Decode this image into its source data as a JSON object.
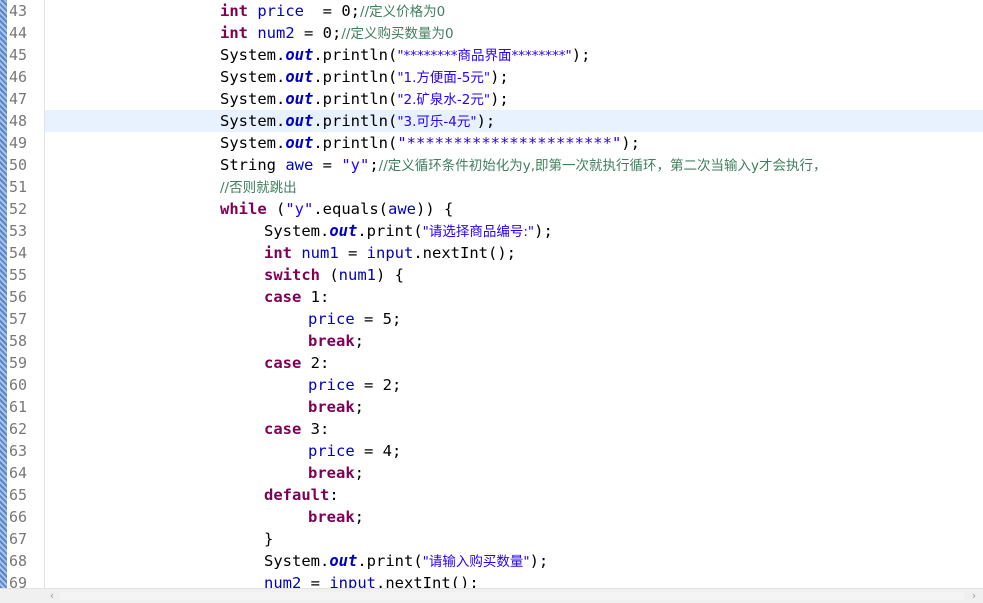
{
  "editor": {
    "lines": [
      {
        "num": "43",
        "indent": 4,
        "tokens": [
          {
            "t": "kw",
            "v": "int"
          },
          {
            "t": "pl",
            "v": " "
          },
          {
            "t": "fld",
            "v": "price"
          },
          {
            "t": "pl",
            "v": "  = 0;"
          },
          {
            "t": "cmt",
            "v": "//定义价格为0"
          }
        ]
      },
      {
        "num": "44",
        "indent": 4,
        "tokens": [
          {
            "t": "kw",
            "v": "int"
          },
          {
            "t": "pl",
            "v": " "
          },
          {
            "t": "fld",
            "v": "num2"
          },
          {
            "t": "pl",
            "v": " = 0;"
          },
          {
            "t": "cmt",
            "v": "//定义购买数量为0"
          }
        ]
      },
      {
        "num": "45",
        "indent": 4,
        "tokens": [
          {
            "t": "pl",
            "v": "System."
          },
          {
            "t": "sfld",
            "v": "out"
          },
          {
            "t": "pl",
            "v": ".println("
          },
          {
            "t": "str",
            "v": "\"********商品界面********\""
          },
          {
            "t": "pl",
            "v": ");"
          }
        ]
      },
      {
        "num": "46",
        "indent": 4,
        "tokens": [
          {
            "t": "pl",
            "v": "System."
          },
          {
            "t": "sfld",
            "v": "out"
          },
          {
            "t": "pl",
            "v": ".println("
          },
          {
            "t": "str",
            "v": "\"1.方便面-5元\""
          },
          {
            "t": "pl",
            "v": ");"
          }
        ]
      },
      {
        "num": "47",
        "indent": 4,
        "tokens": [
          {
            "t": "pl",
            "v": "System."
          },
          {
            "t": "sfld",
            "v": "out"
          },
          {
            "t": "pl",
            "v": ".println("
          },
          {
            "t": "str",
            "v": "\"2.矿泉水-2元\""
          },
          {
            "t": "pl",
            "v": ");"
          }
        ]
      },
      {
        "num": "48",
        "indent": 4,
        "current": true,
        "tokens": [
          {
            "t": "pl",
            "v": "System."
          },
          {
            "t": "sfld",
            "v": "out"
          },
          {
            "t": "pl",
            "v": ".println("
          },
          {
            "t": "str",
            "v": "\"3.可乐-4元\""
          },
          {
            "t": "pl",
            "v": ");"
          }
        ]
      },
      {
        "num": "49",
        "indent": 4,
        "tokens": [
          {
            "t": "pl",
            "v": "System."
          },
          {
            "t": "sfld",
            "v": "out"
          },
          {
            "t": "pl",
            "v": ".println("
          },
          {
            "t": "str",
            "v": "\"**********************\""
          },
          {
            "t": "pl",
            "v": ");"
          }
        ]
      },
      {
        "num": "50",
        "indent": 4,
        "tokens": [
          {
            "t": "pl",
            "v": "String "
          },
          {
            "t": "fld",
            "v": "awe"
          },
          {
            "t": "pl",
            "v": " = "
          },
          {
            "t": "str",
            "v": "\"y\""
          },
          {
            "t": "pl",
            "v": ";"
          },
          {
            "t": "cmt",
            "v": "//定义循环条件初始化为y,即第一次就执行循环，第二次当输入y才会执行，"
          }
        ]
      },
      {
        "num": "51",
        "indent": 4,
        "tokens": [
          {
            "t": "cmt",
            "v": "//否则就跳出"
          }
        ]
      },
      {
        "num": "52",
        "indent": 4,
        "tokens": [
          {
            "t": "kw",
            "v": "while"
          },
          {
            "t": "pl",
            "v": " ("
          },
          {
            "t": "str",
            "v": "\"y\""
          },
          {
            "t": "pl",
            "v": ".equals("
          },
          {
            "t": "fld",
            "v": "awe"
          },
          {
            "t": "pl",
            "v": ")) {"
          }
        ]
      },
      {
        "num": "53",
        "indent": 5,
        "tokens": [
          {
            "t": "pl",
            "v": "System."
          },
          {
            "t": "sfld",
            "v": "out"
          },
          {
            "t": "pl",
            "v": ".print("
          },
          {
            "t": "str",
            "v": "\"请选择商品编号:\""
          },
          {
            "t": "pl",
            "v": ");"
          }
        ]
      },
      {
        "num": "54",
        "indent": 5,
        "tokens": [
          {
            "t": "kw",
            "v": "int"
          },
          {
            "t": "pl",
            "v": " "
          },
          {
            "t": "fld",
            "v": "num1"
          },
          {
            "t": "pl",
            "v": " = "
          },
          {
            "t": "fld",
            "v": "input"
          },
          {
            "t": "pl",
            "v": ".nextInt();"
          }
        ]
      },
      {
        "num": "55",
        "indent": 5,
        "tokens": [
          {
            "t": "kw",
            "v": "switch"
          },
          {
            "t": "pl",
            "v": " ("
          },
          {
            "t": "fld",
            "v": "num1"
          },
          {
            "t": "pl",
            "v": ") {"
          }
        ]
      },
      {
        "num": "56",
        "indent": 5,
        "tokens": [
          {
            "t": "kw",
            "v": "case"
          },
          {
            "t": "pl",
            "v": " 1:"
          }
        ]
      },
      {
        "num": "57",
        "indent": 6,
        "tokens": [
          {
            "t": "fld",
            "v": "price"
          },
          {
            "t": "pl",
            "v": " = 5;"
          }
        ]
      },
      {
        "num": "58",
        "indent": 6,
        "tokens": [
          {
            "t": "kw",
            "v": "break"
          },
          {
            "t": "pl",
            "v": ";"
          }
        ]
      },
      {
        "num": "59",
        "indent": 5,
        "tokens": [
          {
            "t": "kw",
            "v": "case"
          },
          {
            "t": "pl",
            "v": " 2:"
          }
        ]
      },
      {
        "num": "60",
        "indent": 6,
        "tokens": [
          {
            "t": "fld",
            "v": "price"
          },
          {
            "t": "pl",
            "v": " = 2;"
          }
        ]
      },
      {
        "num": "61",
        "indent": 6,
        "tokens": [
          {
            "t": "kw",
            "v": "break"
          },
          {
            "t": "pl",
            "v": ";"
          }
        ]
      },
      {
        "num": "62",
        "indent": 5,
        "tokens": [
          {
            "t": "kw",
            "v": "case"
          },
          {
            "t": "pl",
            "v": " 3:"
          }
        ]
      },
      {
        "num": "63",
        "indent": 6,
        "tokens": [
          {
            "t": "fld",
            "v": "price"
          },
          {
            "t": "pl",
            "v": " = 4;"
          }
        ]
      },
      {
        "num": "64",
        "indent": 6,
        "tokens": [
          {
            "t": "kw",
            "v": "break"
          },
          {
            "t": "pl",
            "v": ";"
          }
        ]
      },
      {
        "num": "65",
        "indent": 5,
        "tokens": [
          {
            "t": "kw",
            "v": "default"
          },
          {
            "t": "pl",
            "v": ":"
          }
        ]
      },
      {
        "num": "66",
        "indent": 6,
        "tokens": [
          {
            "t": "kw",
            "v": "break"
          },
          {
            "t": "pl",
            "v": ";"
          }
        ]
      },
      {
        "num": "67",
        "indent": 5,
        "tokens": [
          {
            "t": "pl",
            "v": "}"
          }
        ]
      },
      {
        "num": "68",
        "indent": 5,
        "tokens": [
          {
            "t": "pl",
            "v": "System."
          },
          {
            "t": "sfld",
            "v": "out"
          },
          {
            "t": "pl",
            "v": ".print("
          },
          {
            "t": "str",
            "v": "\"请输入购买数量\""
          },
          {
            "t": "pl",
            "v": ");"
          }
        ]
      },
      {
        "num": "69",
        "indent": 5,
        "tokens": [
          {
            "t": "fld",
            "v": "num2"
          },
          {
            "t": "pl",
            "v": " = "
          },
          {
            "t": "fld",
            "v": "input"
          },
          {
            "t": "pl",
            "v": ".nextInt();"
          }
        ]
      }
    ]
  },
  "scrollbar": {
    "left_arrow": "‹",
    "right_arrow": "›"
  },
  "colors": {
    "keyword": "#7f0055",
    "field": "#0000c0",
    "string": "#2a00ff",
    "comment": "#3f7f5f",
    "line_number": "#787878",
    "current_line": "#e8f2fe"
  }
}
